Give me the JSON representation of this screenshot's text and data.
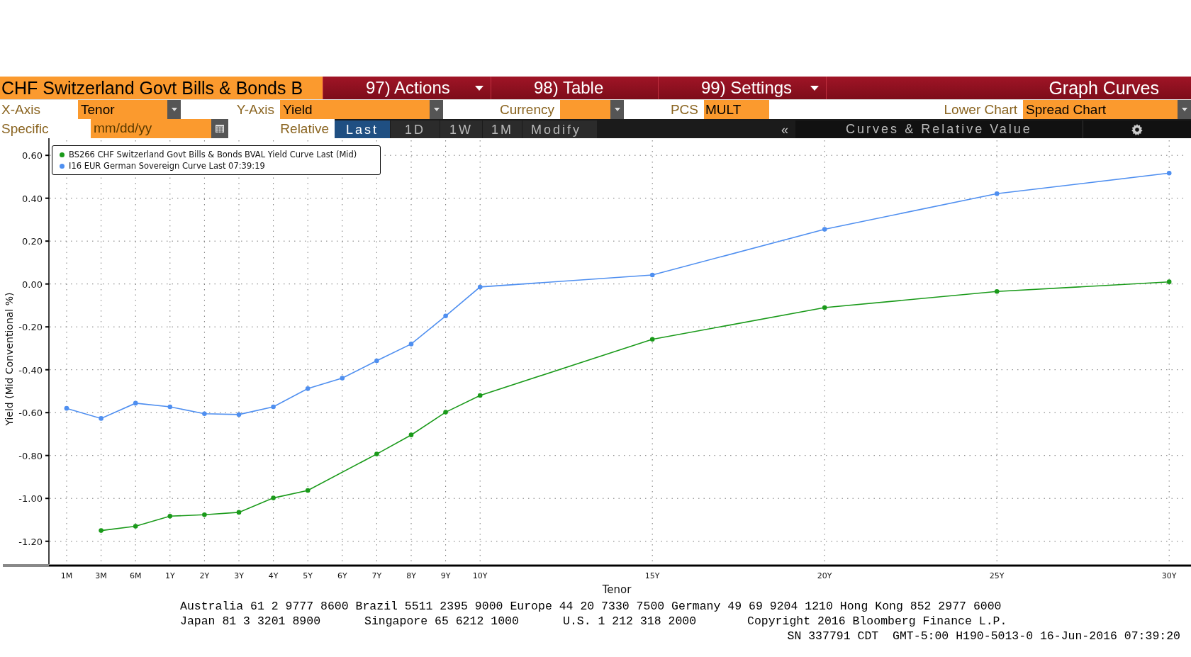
{
  "header": {
    "security": "CHF Switzerland Govt Bills & Bonds B",
    "menus": [
      {
        "label": "97) Actions",
        "dropdown": true
      },
      {
        "label": "98) Table",
        "dropdown": false
      },
      {
        "label": "99) Settings",
        "dropdown": true
      }
    ],
    "screen_title": "Graph Curves"
  },
  "options": {
    "x_axis": {
      "label": "X-Axis",
      "value": "Tenor"
    },
    "y_axis": {
      "label": "Y-Axis",
      "value": "Yield"
    },
    "currency": {
      "label": "Currency"
    },
    "pcs": {
      "label": "PCS",
      "value": "MULT"
    },
    "lower_chart": {
      "label": "Lower Chart",
      "value": "Spread Chart"
    }
  },
  "toolbar": {
    "specific": {
      "label": "Specific",
      "placeholder": "mm/dd/yy"
    },
    "relative": {
      "label": "Relative"
    },
    "periods": [
      {
        "label": "Last",
        "selected": true
      },
      {
        "label": "1D",
        "selected": false
      },
      {
        "label": "1W",
        "selected": false
      },
      {
        "label": "1M",
        "selected": false
      }
    ],
    "modify": "Modify",
    "collapse": "«",
    "panel_title": "Curves & Relative Value"
  },
  "chart": {
    "chart_data": {
      "type": "line",
      "xlabel": "Tenor",
      "ylabel": "Yield (Mid Conventional %)",
      "categories": [
        "1M",
        "3M",
        "6M",
        "1Y",
        "2Y",
        "3Y",
        "4Y",
        "5Y",
        "6Y",
        "7Y",
        "8Y",
        "9Y",
        "10Y",
        null,
        null,
        null,
        null,
        "15Y",
        null,
        null,
        null,
        null,
        "20Y",
        null,
        null,
        null,
        null,
        "25Y",
        null,
        null,
        null,
        null,
        "30Y"
      ],
      "ylim": [
        -1.31,
        0.67
      ],
      "grid": true,
      "legend": "upper left",
      "yticks": [
        {
          "value": -1.2,
          "label": "-1.20"
        },
        {
          "value": -1.0,
          "label": "-1.00"
        },
        {
          "value": -0.8,
          "label": "-0.80"
        },
        {
          "value": -0.6,
          "label": "-0.60"
        },
        {
          "value": -0.4,
          "label": "-0.40"
        },
        {
          "value": -0.2,
          "label": "-0.20"
        },
        {
          "value": 0,
          "label": "0.00"
        },
        {
          "value": 0.2,
          "label": "0.20"
        },
        {
          "value": 0.4,
          "label": "0.40"
        },
        {
          "value": 0.6,
          "label": "0.60"
        }
      ],
      "series": [
        {
          "name": "BS266 CHF Switzerland Govt Bills & Bonds BVAL Yield Curve Last (Mid)",
          "color": "#1a9a1a",
          "marker": "circle",
          "values": [
            null,
            -1.15,
            -1.13,
            -1.083,
            -1.076,
            -1.065,
            -0.998,
            -0.963,
            null,
            -0.793,
            -0.704,
            -0.598,
            -0.52,
            null,
            null,
            null,
            null,
            -0.258,
            null,
            null,
            null,
            null,
            -0.11,
            null,
            null,
            null,
            null,
            -0.035,
            null,
            null,
            null,
            null,
            0.01
          ]
        },
        {
          "name": "I16 EUR German Sovereign Curve Last 07:39:19",
          "color": "#4f8ff0",
          "marker": "circle",
          "values": [
            -0.58,
            -0.627,
            -0.556,
            -0.573,
            -0.605,
            -0.609,
            -0.573,
            -0.488,
            -0.439,
            -0.358,
            -0.28,
            -0.149,
            -0.014,
            null,
            null,
            null,
            null,
            0.042,
            null,
            null,
            null,
            null,
            0.255,
            null,
            null,
            null,
            null,
            0.421,
            null,
            null,
            null,
            null,
            0.517
          ]
        }
      ]
    }
  },
  "footer": {
    "contacts": "Australia 61 2 9777 8600 Brazil 5511 2395 9000 Europe 44 20 7330 7500 Germany 49 69 9204 1210 Hong Kong 852 2977 6000",
    "offices": [
      "Japan 81 3 3201 8900",
      "Singapore 65 6212 1000",
      "U.S. 1 212 318 2000",
      "Copyright 2016 Bloomberg Finance L.P."
    ],
    "session": "SN 337791 CDT  GMT-5:00 H190-5013-0 16-Jun-2016 07:39:20"
  }
}
